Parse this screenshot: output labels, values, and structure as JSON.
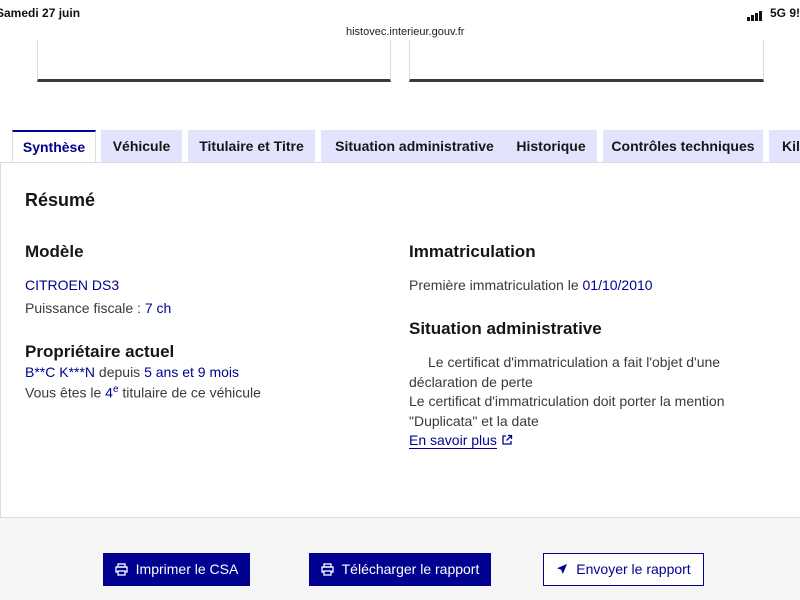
{
  "status": {
    "date": "Samedi 27 juin",
    "network": "5G",
    "battery": "9!"
  },
  "browser": {
    "url": "histovec.interieur.gouv.fr"
  },
  "tabs": [
    {
      "label": "Synthèse",
      "active": true
    },
    {
      "label": "Véhicule",
      "active": false
    },
    {
      "label": "Titulaire et Titre",
      "active": false
    },
    {
      "label": "Situation administrative",
      "active": false
    },
    {
      "label": "Historique",
      "active": false
    },
    {
      "label": "Contrôles techniques",
      "active": false
    },
    {
      "label": "Kil",
      "active": false
    }
  ],
  "summary": {
    "title": "Résumé",
    "model": {
      "heading": "Modèle",
      "name": "CITROEN DS3",
      "fiscal_label": "Puissance fiscale : ",
      "fiscal_value": "7 ch"
    },
    "owner": {
      "heading": "Propriétaire actuel",
      "name": "B**C K***N",
      "since_label": " depuis ",
      "since_value": "5 ans et 9 mois",
      "rank_prefix": "Vous êtes le ",
      "rank_value": "4",
      "rank_sup": "e",
      "rank_suffix": " titulaire de ce véhicule"
    },
    "registration": {
      "heading": "Immatriculation",
      "label": "Première immatriculation le ",
      "date": "01/10/2010"
    },
    "admin": {
      "heading": "Situation administrative",
      "line1": "Le certificat d'immatriculation a fait l'objet d'une déclaration de perte",
      "line2": "Le certificat d'immatriculation doit porter la mention \"Duplicata\" et la date",
      "link": "En savoir plus"
    }
  },
  "actions": {
    "print": "Imprimer le CSA",
    "download": "Télécharger le rapport",
    "send": "Envoyer le rapport"
  },
  "colors": {
    "primary": "#000091",
    "tab_bg": "#e3e3fd",
    "text": "#3a3a3a"
  }
}
